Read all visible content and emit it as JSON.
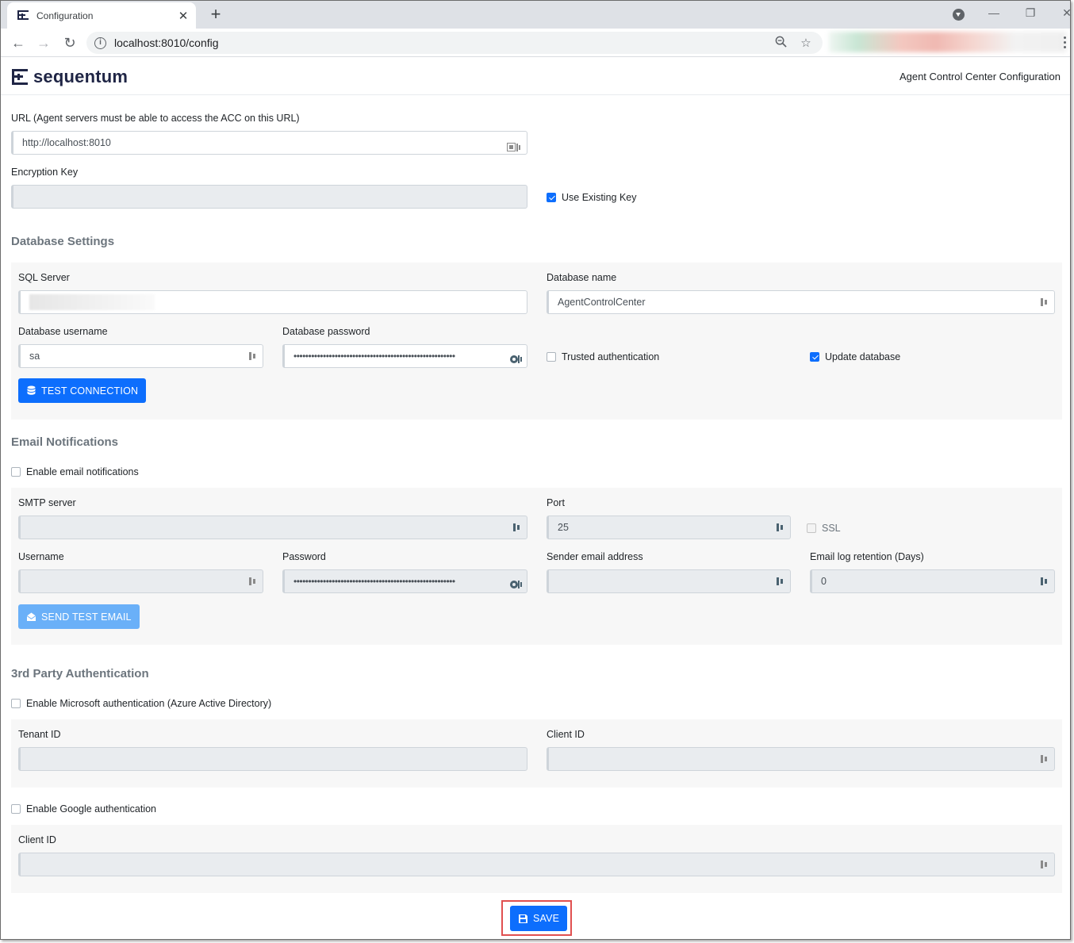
{
  "browser": {
    "tab_title": "Configuration",
    "tab_close": "✕",
    "new_tab": "+",
    "url": "localhost:8010/config",
    "icons": [
      "back-icon",
      "forward-icon",
      "reload-icon",
      "info-icon",
      "zoom-icon",
      "star-icon",
      "profile-icon",
      "menu-icon"
    ]
  },
  "header": {
    "logo_text": "sequentum",
    "title": "Agent Control Center Configuration"
  },
  "general": {
    "url_label": "URL (Agent servers must be able to access the ACC on this URL)",
    "url_value": "http://localhost:8010",
    "encryption_label": "Encryption Key",
    "encryption_value": "",
    "use_existing_key_label": "Use Existing Key",
    "use_existing_key_checked": true
  },
  "database": {
    "section_title": "Database Settings",
    "sql_server_label": "SQL Server",
    "sql_server_value": "",
    "db_name_label": "Database name",
    "db_name_value": "AgentControlCenter",
    "username_label": "Database username",
    "username_value": "sa",
    "password_label": "Database password",
    "password_mask": "•••••••••••••••••••••••••••••••••••••••••••••••••••••••",
    "trusted_auth_label": "Trusted authentication",
    "trusted_auth_checked": false,
    "update_db_label": "Update database",
    "update_db_checked": true,
    "test_button": "TEST CONNECTION"
  },
  "email": {
    "section_title": "Email Notifications",
    "enable_label": "Enable email notifications",
    "enable_checked": false,
    "smtp_label": "SMTP server",
    "smtp_value": "",
    "port_label": "Port",
    "port_value": "25",
    "ssl_label": "SSL",
    "username_label": "Username",
    "username_value": "",
    "password_label": "Password",
    "password_mask": "•••••••••••••••••••••••••••••••••••••••••••••••••••••••",
    "sender_label": "Sender email address",
    "sender_value": "",
    "retention_label": "Email log retention (Days)",
    "retention_value": "0",
    "send_test_button": "SEND TEST EMAIL"
  },
  "auth": {
    "section_title": "3rd Party Authentication",
    "ms_enable_label": "Enable Microsoft authentication (Azure Active Directory)",
    "ms_enable_checked": false,
    "tenant_label": "Tenant ID",
    "tenant_value": "",
    "ms_client_label": "Client ID",
    "ms_client_value": "",
    "google_enable_label": "Enable Google authentication",
    "google_enable_checked": false,
    "google_client_label": "Client ID",
    "google_client_value": ""
  },
  "actions": {
    "save_button": "SAVE"
  },
  "colors": {
    "primary": "#0d6efd",
    "primary_light": "#6ab0f8",
    "highlight_outline": "#e05050",
    "brand_text": "#1f2545"
  }
}
